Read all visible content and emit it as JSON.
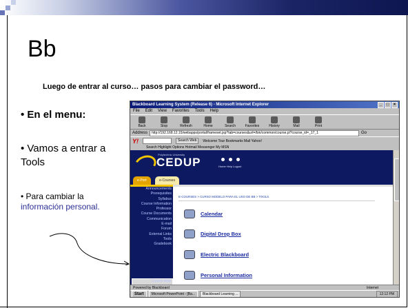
{
  "slide": {
    "title": "Bb",
    "subtitle": "Luego de entrar al curso… pasos para cambiar el password…",
    "bullet1": "• En el menu:",
    "bullet2": "• Vamos a entrar a Tools",
    "bullet3_prefix": "• Para cambiar la ",
    "bullet3_highlight": "información personal.",
    "accent_color": "#2b2e95"
  },
  "browser": {
    "window_title": "Blackboard Learning System (Release 6) - Microsoft Internet Explorer",
    "menu": [
      "File",
      "Edit",
      "View",
      "Favorites",
      "Tools",
      "Help"
    ],
    "toolbar": [
      "Back",
      "Stop",
      "Refresh",
      "Home",
      "Search",
      "Favorites",
      "History",
      "Mail",
      "Print"
    ],
    "address_label": "Address",
    "address": "http://192.168.12.15/webapps/portal/frameset.jsp?tab=courses&url=/bin/common/course.pl?course_id=_17_1",
    "go": "Go",
    "yahoo": {
      "logo": "Y!",
      "search_button": "Search Web",
      "toolbar_row1": "Welcome Tour   Bookmarks   Mail   Yahoo!",
      "toolbar_row2": "Search   Highlight   Options   Hotmail   Messenger   My MSN"
    },
    "status": "Powered by Blackboard",
    "zone": "Internet"
  },
  "site": {
    "logo": "CEDUP",
    "logo_small": "Polytechnic University",
    "header_links": "Home   Help   Logout",
    "tabs": [
      "e-Port",
      "e-Courses"
    ],
    "breadcrumb": "E-COURSES > CURSO MODELO PARA EL USO DE BB > TOOLS",
    "sidebar": [
      "Announcements",
      "Prerequisites",
      "Syllabus",
      "Course Information",
      "Professor",
      "Course Documents",
      "Communication",
      "E-mail",
      "Forum",
      "External Links",
      "Tools",
      "Gradebook"
    ],
    "course_map": "Course Map",
    "tools": [
      "Calendar",
      "Digital Drop Box",
      "Electric Blackboard",
      "Personal Information"
    ]
  },
  "taskbar": {
    "start": "Start",
    "tasks": [
      "Microsoft PowerPoint - [Ba...",
      "Blackboard Learning ..."
    ],
    "clock": "12:12 PM"
  }
}
